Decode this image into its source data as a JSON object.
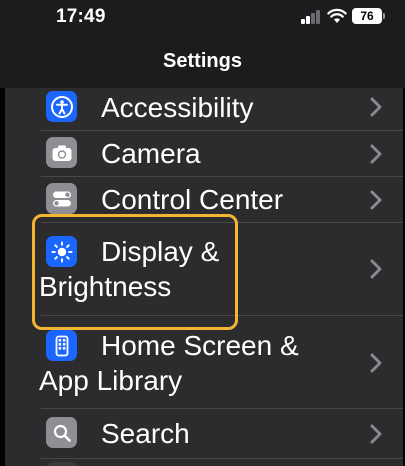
{
  "status_bar": {
    "time": "17:49",
    "battery": "76"
  },
  "nav": {
    "title": "Settings"
  },
  "rows": [
    {
      "label": "Accessibility",
      "icon": "accessibility-icon",
      "color": "#1a66ff"
    },
    {
      "label": "Camera",
      "icon": "camera-icon",
      "color": "#8e8e93"
    },
    {
      "label": "Control Center",
      "icon": "control-center-icon",
      "color": "#8e8e93"
    },
    {
      "label_line1": "Display &",
      "label_line2": "Brightness",
      "icon": "sun-icon",
      "color": "#1a66ff"
    },
    {
      "label_line1": "Home Screen &",
      "label_line2": "App Library",
      "icon": "home-screen-icon",
      "color": "#1a66ff"
    },
    {
      "label": "Search",
      "icon": "search-icon",
      "color": "#8e8e93"
    }
  ],
  "highlight_color": "#f4b632"
}
